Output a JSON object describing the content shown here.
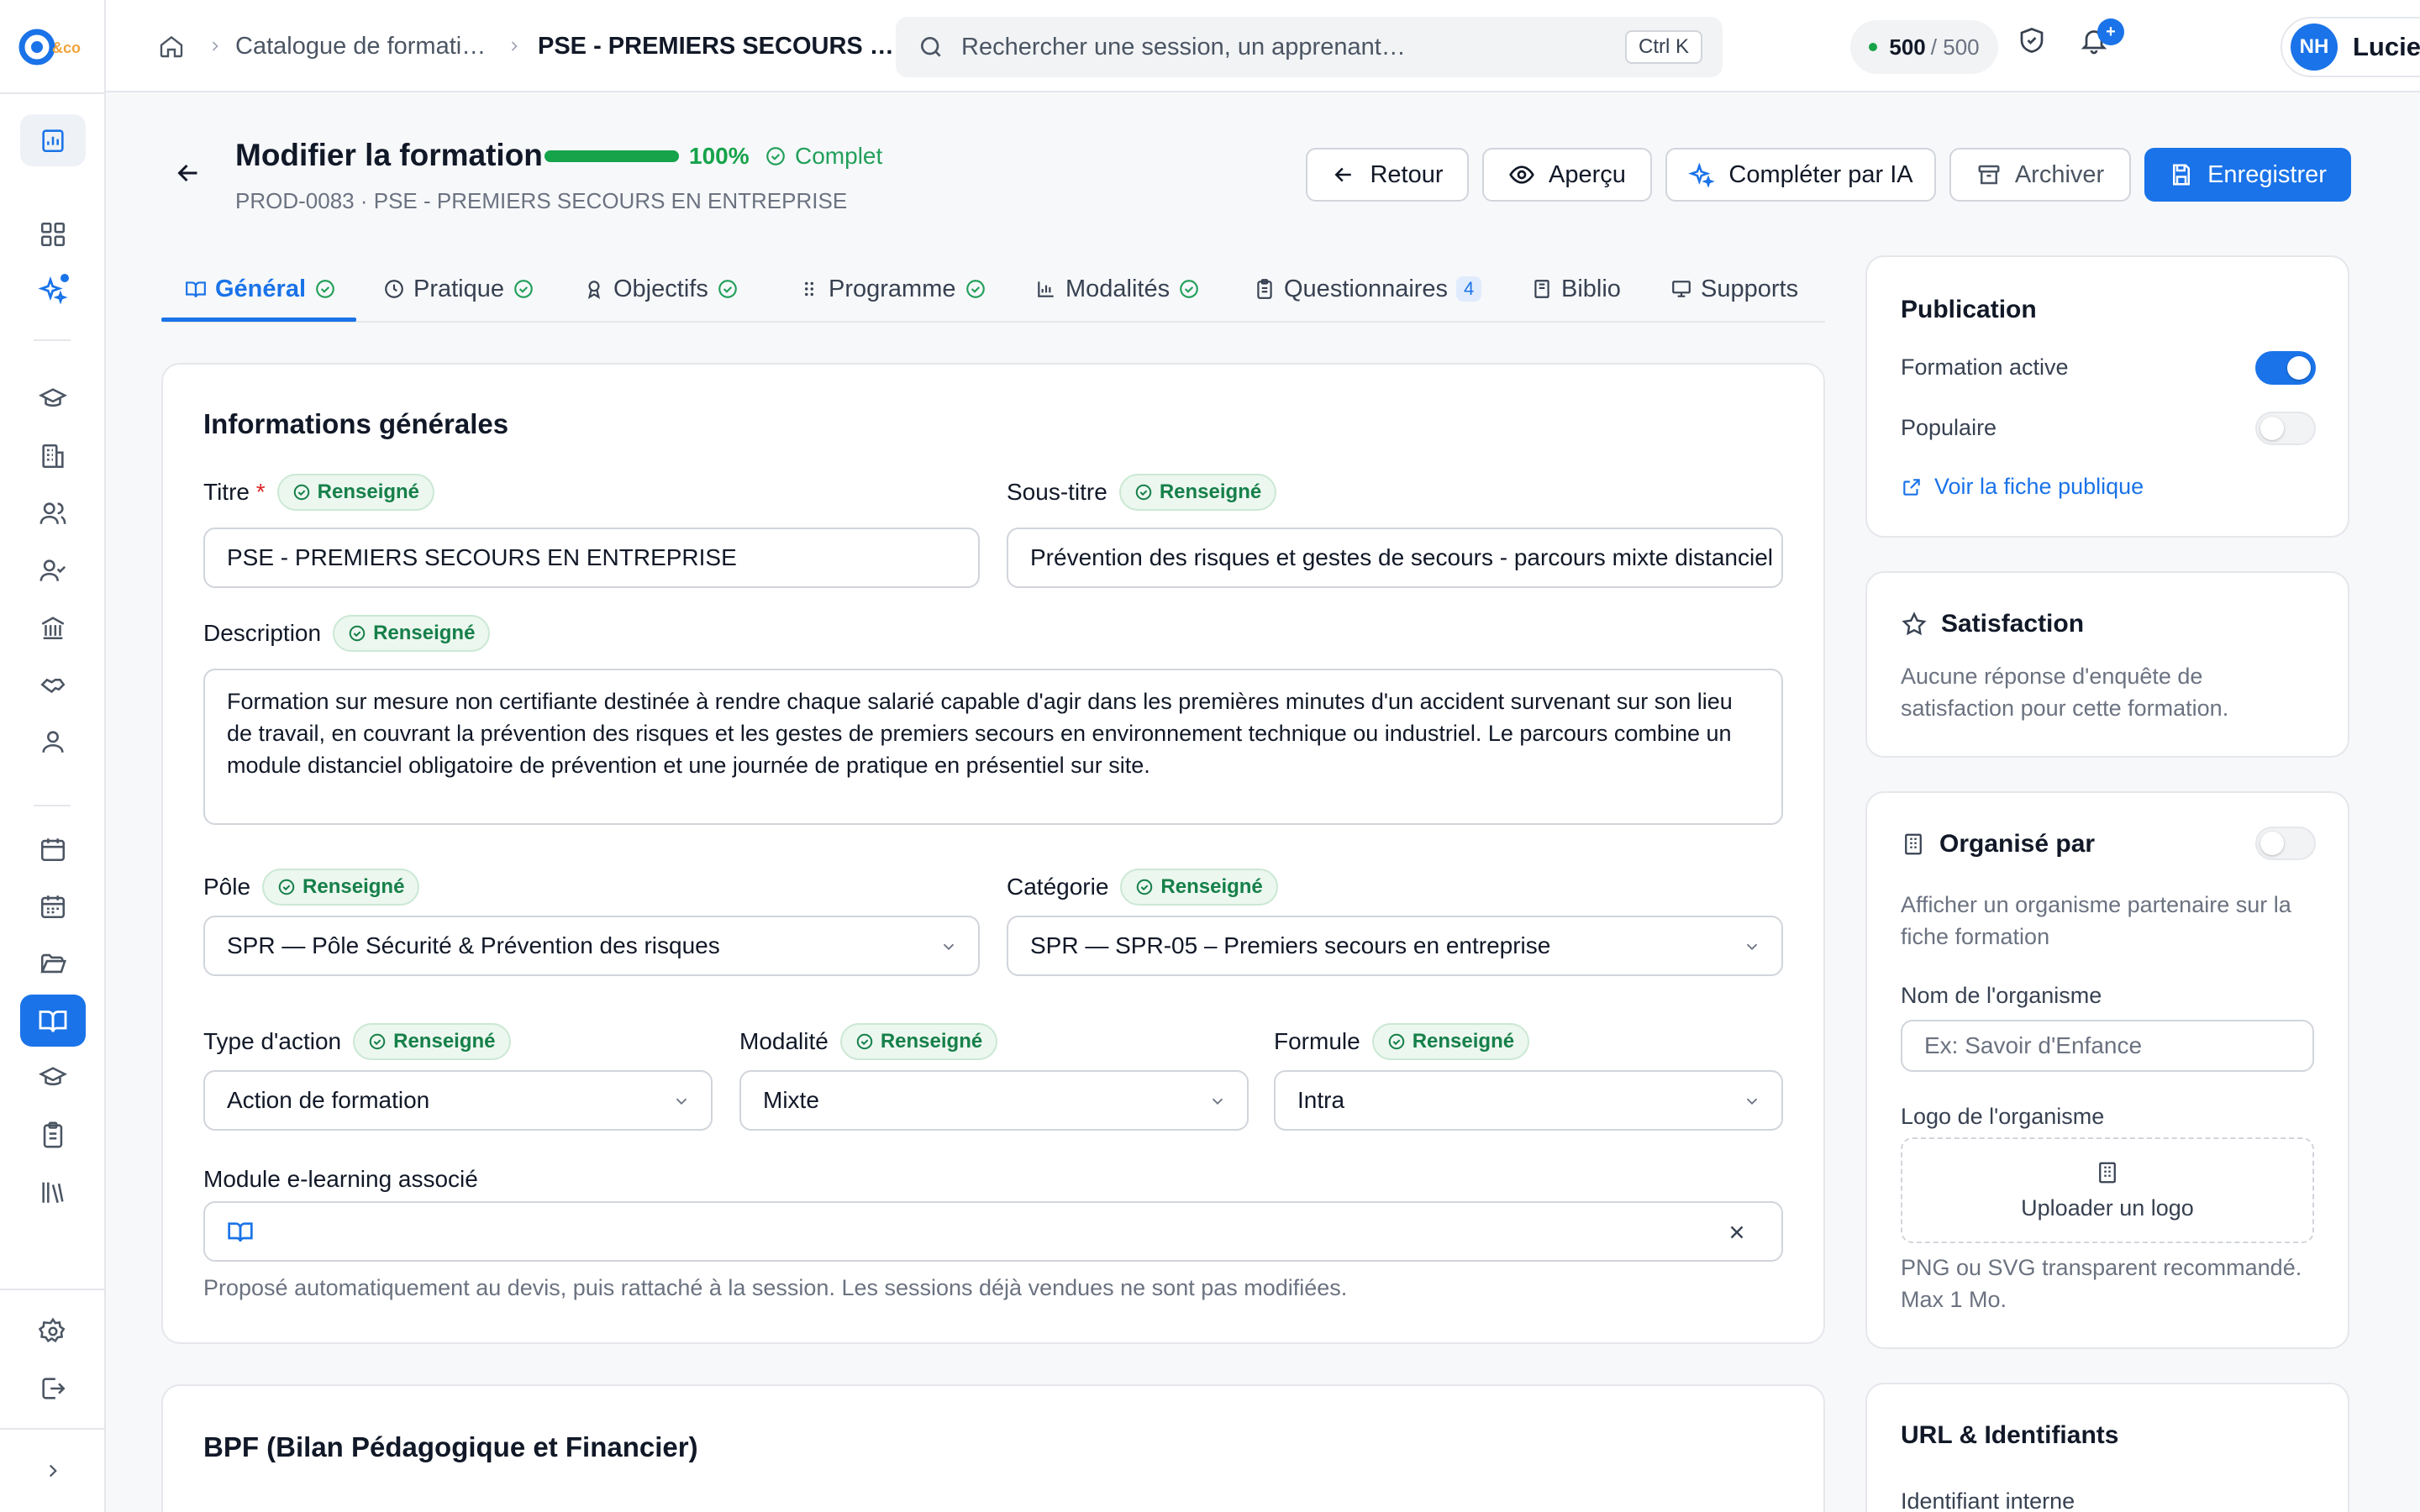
{
  "app": {
    "logo_text": "&co",
    "accent": "#1a73e8",
    "success": "#16a34a"
  },
  "breadcrumb": {
    "catalogue": "Catalogue de formati…",
    "current": "PSE - PREMIERS SECOURS …"
  },
  "search": {
    "placeholder": "Rechercher une session, un apprenant…",
    "shortcut": "Ctrl K"
  },
  "quota": {
    "used": "500",
    "total": "/ 500"
  },
  "notifications": {
    "badge": "+"
  },
  "user": {
    "initials": "NH",
    "name": "Lucie"
  },
  "header": {
    "title": "Modifier la formation",
    "progress_percent": "100%",
    "progress_value": 1.0,
    "status": "Complet",
    "subtitle": "PROD-0083 · PSE - PREMIERS SECOURS EN ENTREPRISE",
    "buttons": {
      "back": "Retour",
      "preview": "Aperçu",
      "ai": "Compléter par IA",
      "archive": "Archiver",
      "save": "Enregistrer"
    }
  },
  "tabs": [
    {
      "label": "Général",
      "state": "complete",
      "icon": "book-icon"
    },
    {
      "label": "Pratique",
      "state": "complete",
      "icon": "clock-icon"
    },
    {
      "label": "Objectifs",
      "state": "complete",
      "icon": "award-icon"
    },
    {
      "label": "Programme",
      "state": "complete",
      "icon": "grip-icon"
    },
    {
      "label": "Modalités",
      "state": "complete",
      "icon": "chart-icon"
    },
    {
      "label": "Questionnaires",
      "count": "4",
      "icon": "clipboard-icon"
    },
    {
      "label": "Biblio",
      "icon": "library-icon"
    },
    {
      "label": "Supports",
      "icon": "presentation-icon"
    }
  ],
  "general": {
    "title": "Informations générales",
    "badge": "Renseigné",
    "fields": {
      "titre": {
        "label": "Titre",
        "required": "*",
        "value": "PSE - PREMIERS SECOURS EN ENTREPRISE"
      },
      "sous_titre": {
        "label": "Sous-titre",
        "value": "Prévention des risques et gestes de secours - parcours mixte distanciel"
      },
      "description": {
        "label": "Description",
        "value": "Formation sur mesure non certifiante destinée à rendre chaque salarié capable d'agir dans les premières minutes d'un accident survenant sur son lieu de travail, en couvrant la prévention des risques et les gestes de premiers secours en environnement technique ou industriel. Le parcours combine un module distanciel obligatoire de prévention et une journée de pratique en présentiel sur site."
      },
      "pole": {
        "label": "Pôle",
        "value": "SPR — Pôle Sécurité & Prévention des risques"
      },
      "categorie": {
        "label": "Catégorie",
        "value": "SPR — SPR-05 – Premiers secours en entreprise"
      },
      "type_action": {
        "label": "Type d'action",
        "value": "Action de formation"
      },
      "modalite": {
        "label": "Modalité",
        "value": "Mixte"
      },
      "formule": {
        "label": "Formule",
        "value": "Intra"
      },
      "module": {
        "label": "Module e-learning associé",
        "value": ""
      }
    },
    "hint": "Proposé automatiquement au devis, puis rattaché à la session. Les sessions déjà vendues ne sont pas modifiées."
  },
  "bpf": {
    "title": "BPF (Bilan Pédagogique et Financier)"
  },
  "publication": {
    "title": "Publication",
    "active_label": "Formation active",
    "active": true,
    "popular_label": "Populaire",
    "popular": false,
    "public_link": "Voir la fiche publique"
  },
  "satisfaction": {
    "title": "Satisfaction",
    "message": "Aucune réponse d'enquête de satisfaction pour cette formation."
  },
  "organise": {
    "title": "Organisé par",
    "enabled": false,
    "description": "Afficher un organisme partenaire sur la fiche formation",
    "name_label": "Nom de l'organisme",
    "name_placeholder": "Ex: Savoir d'Enfance",
    "logo_label": "Logo de l'organisme",
    "upload_label": "Uploader un logo",
    "logo_hint": "PNG ou SVG transparent recommandé. Max 1 Mo."
  },
  "url_ids": {
    "title": "URL & Identifiants",
    "internal_id_label": "Identifiant interne"
  }
}
